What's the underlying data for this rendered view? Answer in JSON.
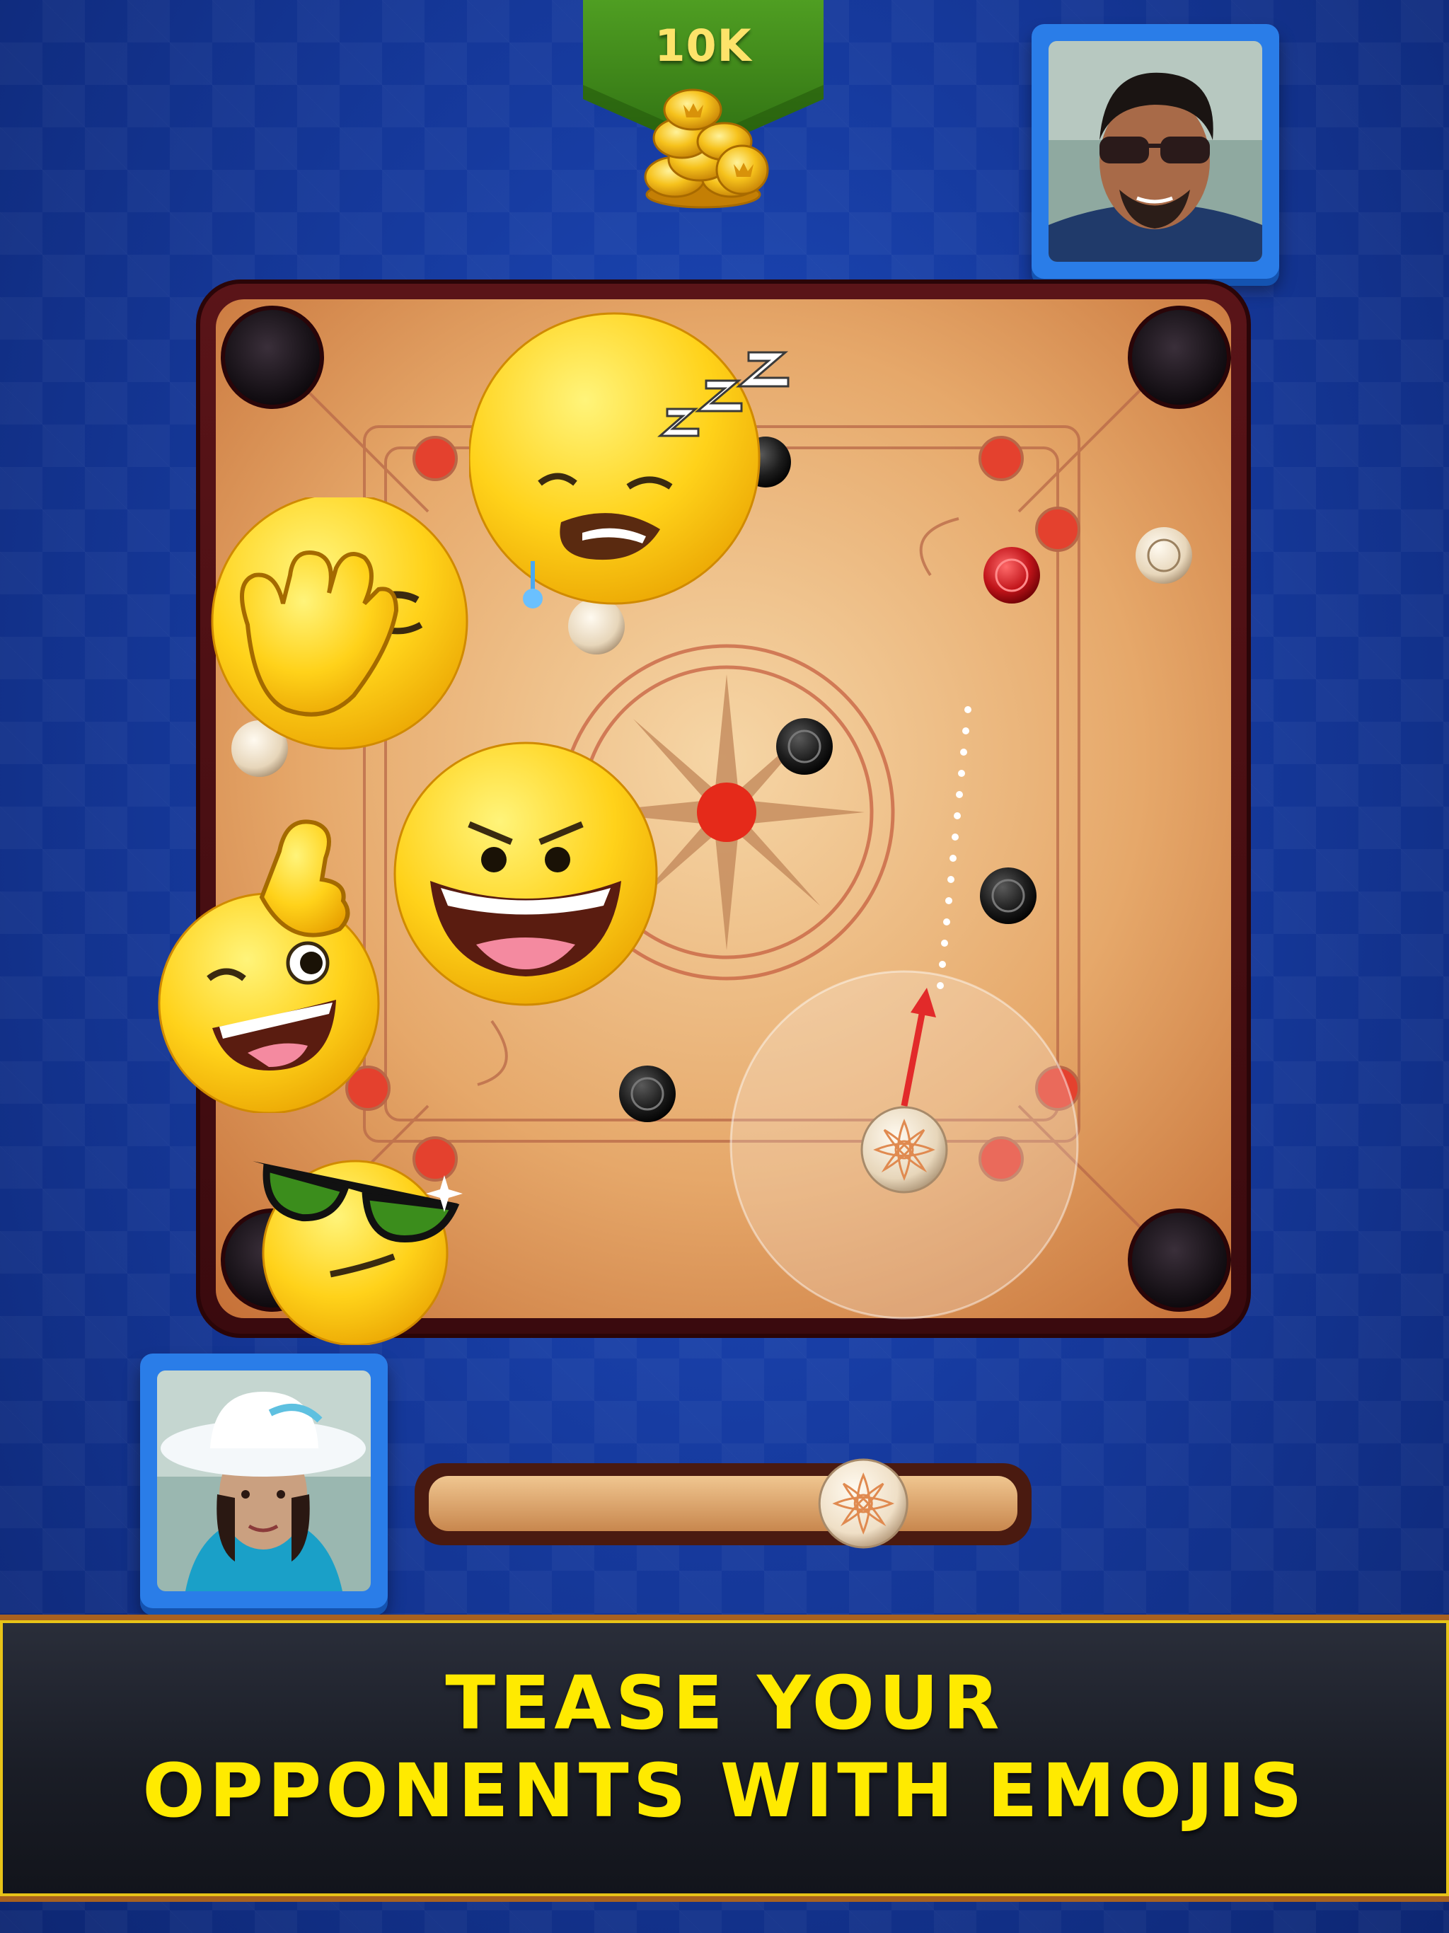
{
  "coins": {
    "amount_label": "10K",
    "icon": "gold-coins-icon",
    "banner_color": "#3f8f1a"
  },
  "players": {
    "opponent": {
      "avatar": "opponent-avatar",
      "frame_color": "#2a7de8"
    },
    "self": {
      "avatar": "player-avatar",
      "frame_color": "#2a7de8"
    }
  },
  "board": {
    "pieces": [
      "black",
      "white",
      "queen-red"
    ],
    "emojis": [
      "sleeping-emoji",
      "facepalm-emoji",
      "laughing-emoji",
      "thumbs-up-wink-emoji",
      "cool-sunglasses-emoji"
    ]
  },
  "striker_slider": {
    "position_fraction": 0.78
  },
  "footer": {
    "line1": "TEASE YOUR",
    "line2": "OPPONENTS WITH EMOJIS",
    "text_color": "#ffea00"
  }
}
